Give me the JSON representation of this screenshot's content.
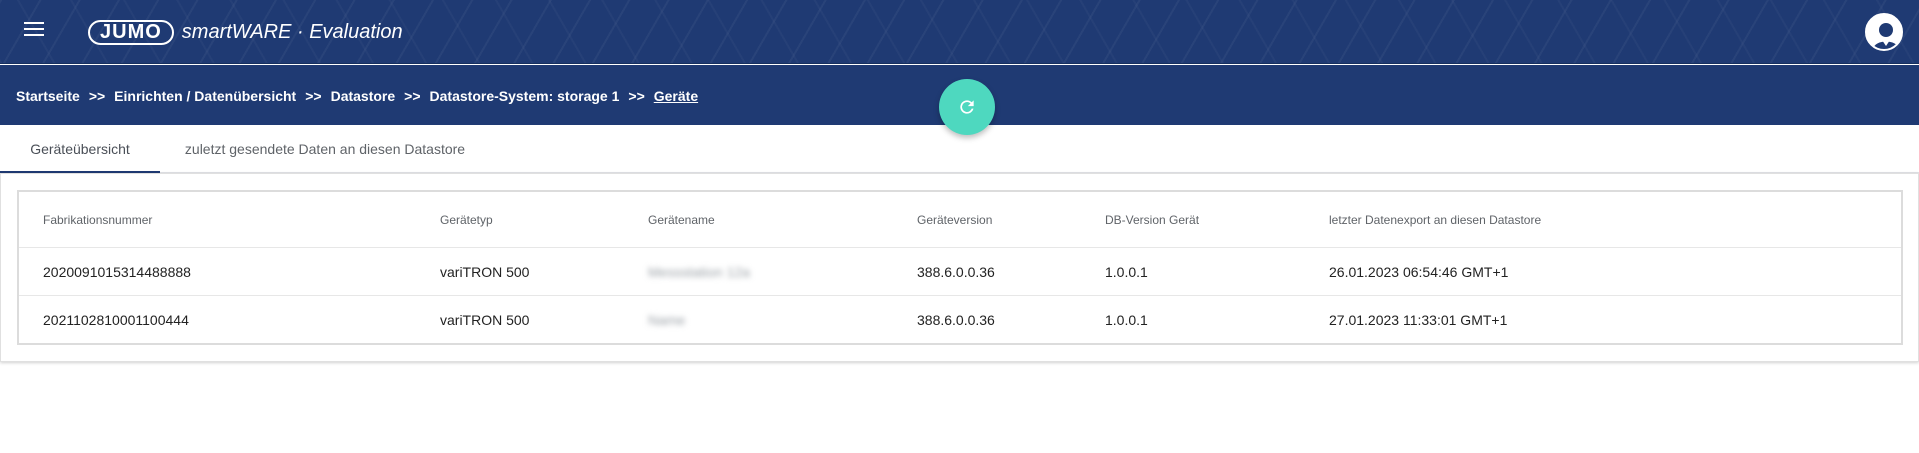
{
  "app": {
    "title": "smartWARE · Evaluation",
    "brand": "JUMO",
    "menu_icon": "menu-icon",
    "avatar_icon": "user-avatar-icon",
    "colors": {
      "primary": "#1f3a73",
      "accent": "#4ed8bf"
    }
  },
  "breadcrumb": {
    "items": [
      {
        "label": "Startseite"
      },
      {
        "label": "Einrichten / Datenübersicht"
      },
      {
        "label": "Datastore"
      },
      {
        "label": "Datastore-System: storage 1"
      },
      {
        "label": "Geräte"
      }
    ],
    "separator": ">>"
  },
  "refresh_button": {
    "icon": "refresh-icon"
  },
  "tabs": [
    {
      "label": "Geräteübersicht",
      "active": true
    },
    {
      "label": "zuletzt gesendete Daten an diesen Datastore",
      "active": false
    }
  ],
  "table": {
    "headers": [
      "Fabrikationsnummer",
      "Gerätetyp",
      "Gerätename",
      "Geräteversion",
      "DB-Version Gerät",
      "letzter Datenexport an diesen Datastore"
    ],
    "rows": [
      [
        "2020091015314488888",
        "variTRON 500",
        "Messstation 12a",
        "388.6.0.0.36",
        "1.0.0.1",
        "26.01.2023 06:54:46 GMT+1"
      ],
      [
        "2021102810001100444",
        "variTRON 500",
        "Name",
        "388.6.0.0.36",
        "1.0.0.1",
        "27.01.2023 11:33:01 GMT+1"
      ]
    ]
  }
}
